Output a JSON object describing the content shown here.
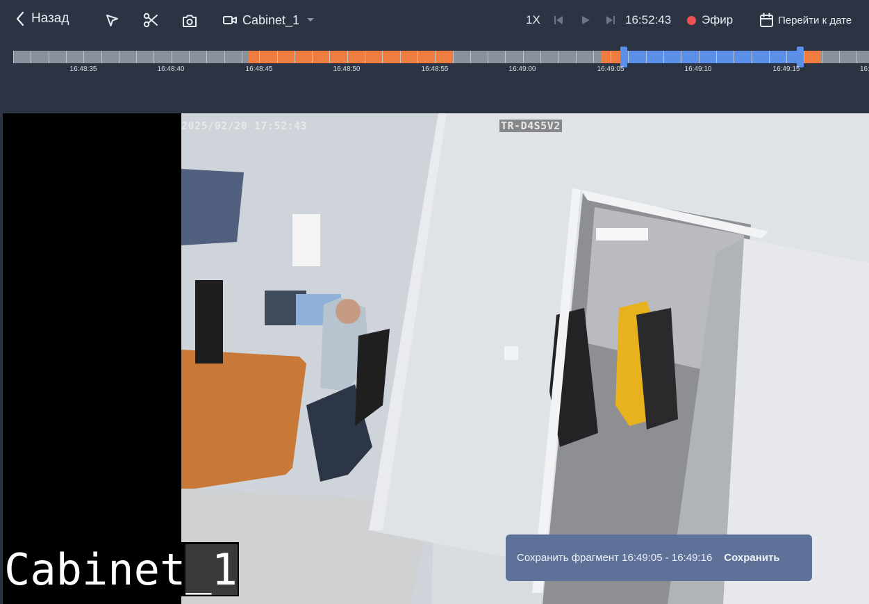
{
  "topbar": {
    "back_label": "Назад",
    "camera_name": "Cabinet_1",
    "speed": "1X",
    "time": "16:52:43",
    "live_label": "Эфир",
    "goto_date_label": "Перейти к дате",
    "icons": [
      "chevron-left-icon",
      "cursor-icon",
      "scissors-icon",
      "camera-snapshot-icon",
      "video-camera-icon",
      "caret-down-icon",
      "skip-back-icon",
      "play-icon",
      "skip-forward-icon",
      "live-dot-icon",
      "calendar-icon"
    ],
    "colors": {
      "bg": "#2c3443",
      "live_dot": "#f05252",
      "text": "#e7ebf2",
      "muted": "#7b8495"
    }
  },
  "timeline": {
    "labels": [
      "16:48:35",
      "16:48:40",
      "16:48:45",
      "16:48:50",
      "16:48:55",
      "16:49:00",
      "16:49:05",
      "16:49:10",
      "16:49:15",
      "16:"
    ],
    "colors": {
      "track": "#8a909c",
      "recording": "#ef7d41",
      "selection": "#5b8fe8"
    }
  },
  "video": {
    "osd_datetime": "2025/02/20 17:52:43",
    "osd_model": "TR-D4S5V2",
    "camera_label_main": "Cabinet",
    "camera_label_tail": "_1"
  },
  "toast": {
    "message": "Сохранить фрагмент 16:49:05 - 16:49:16",
    "action_label": "Сохранить"
  }
}
